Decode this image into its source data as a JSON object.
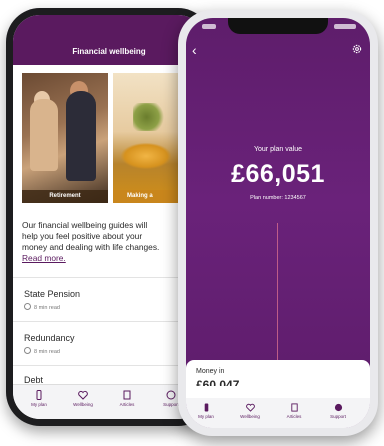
{
  "back_phone": {
    "header_title": "Financial wellbeing",
    "tiles": [
      {
        "label": "Retirement"
      },
      {
        "label": "Making a"
      }
    ],
    "intro_lines": [
      "Our financial wellbeing guides will",
      "help you feel positive about your",
      "money and dealing with life changes."
    ],
    "read_more": "Read more.",
    "guides": [
      {
        "title": "State Pension",
        "meta": "8 min read"
      },
      {
        "title": "Redundancy",
        "meta": "8 min read"
      },
      {
        "title": "Debt",
        "meta": ""
      }
    ],
    "tabs": [
      {
        "label": "My plan",
        "icon": "phone-icon"
      },
      {
        "label": "Wellbeing",
        "icon": "heart-icon"
      },
      {
        "label": "Articles",
        "icon": "document-icon"
      },
      {
        "label": "Support",
        "icon": "help-icon"
      }
    ]
  },
  "front_phone": {
    "plan_label": "Your plan value",
    "plan_value": "£66,051",
    "plan_number": "Plan number: 1234567",
    "card_title": "Money in",
    "card_value": "£60,047",
    "tabs": [
      {
        "label": "My plan",
        "icon": "phone-icon"
      },
      {
        "label": "Wellbeing",
        "icon": "heart-icon"
      },
      {
        "label": "Articles",
        "icon": "document-icon"
      },
      {
        "label": "Support",
        "icon": "help-icon"
      }
    ]
  },
  "colors": {
    "brand_purple": "#5a1a5f",
    "accent_orange": "#c9861c"
  }
}
